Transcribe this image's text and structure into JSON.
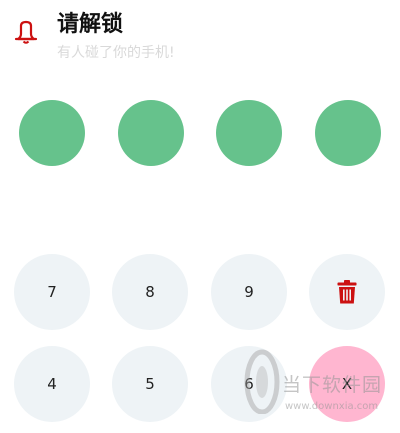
{
  "header": {
    "icon": "bell-icon",
    "title": "请解锁",
    "subtitle": "有人碰了你的手机!"
  },
  "pin_dots": {
    "count": 4,
    "filled": 4,
    "color": "#66c28c"
  },
  "keypad": {
    "rows": [
      [
        {
          "label": "7"
        },
        {
          "label": "8"
        },
        {
          "label": "9"
        },
        {
          "icon": "trash-icon"
        }
      ],
      [
        {
          "label": "4"
        },
        {
          "label": "5"
        },
        {
          "label": "6"
        },
        {
          "label": "X"
        }
      ]
    ],
    "delete_color": "#cc1111",
    "close_color": "#ffb6d0"
  },
  "watermark": {
    "text": "当下软件园",
    "url": "www.downxia.com"
  }
}
